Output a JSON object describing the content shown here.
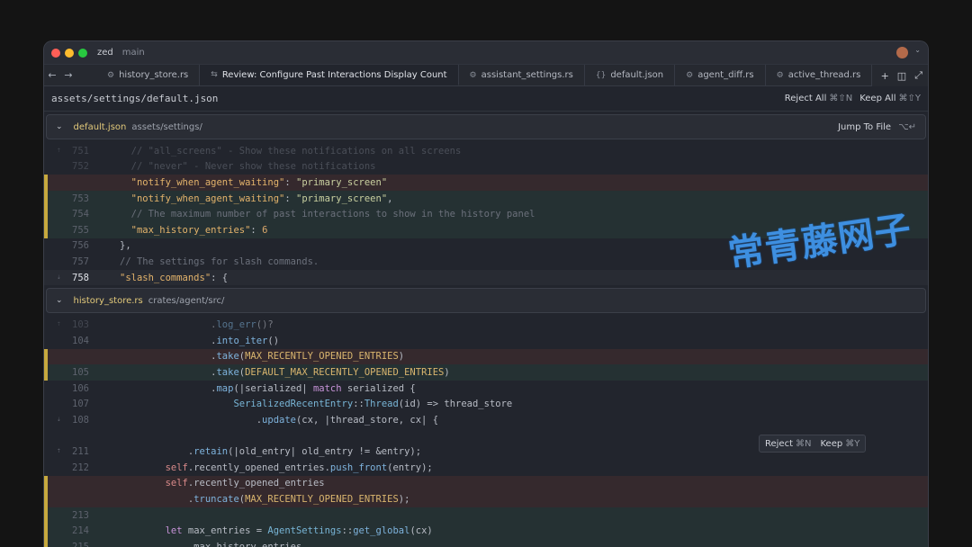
{
  "window": {
    "app_name": "zed",
    "branch": "main",
    "colors": {
      "close": "#ff5f57",
      "minimize": "#febc2e",
      "maximize": "#28c840",
      "accent_yellow": "#c7a93e"
    }
  },
  "tabs": [
    {
      "label": "history_store.rs",
      "icon": "rust-file-icon"
    },
    {
      "label": "Review: Configure Past Interactions Display Count",
      "icon": "diff-review-icon"
    },
    {
      "label": "assistant_settings.rs",
      "icon": "rust-file-icon"
    },
    {
      "label": "default.json",
      "icon": "json-file-icon"
    },
    {
      "label": "agent_diff.rs",
      "icon": "rust-file-icon"
    },
    {
      "label": "active_thread.rs",
      "icon": "rust-file-icon"
    }
  ],
  "toolbar": {
    "path": "assets/settings/default.json",
    "reject_all": "Reject All",
    "reject_all_kbd": "⌘⇧N",
    "keep_all": "Keep All",
    "keep_all_kbd": "⌘⇧Y"
  },
  "file1": {
    "name": "default.json",
    "dir": "assets/settings/",
    "jump": "Jump To File",
    "jump_kbd": "⌥↵"
  },
  "file2": {
    "name": "history_store.rs",
    "dir": "crates/agent/src/"
  },
  "hunk_popup": {
    "reject": "Reject",
    "reject_kbd": "⌘N",
    "keep": "Keep",
    "keep_kbd": "⌘Y"
  },
  "watermark": "常青藤网子"
}
